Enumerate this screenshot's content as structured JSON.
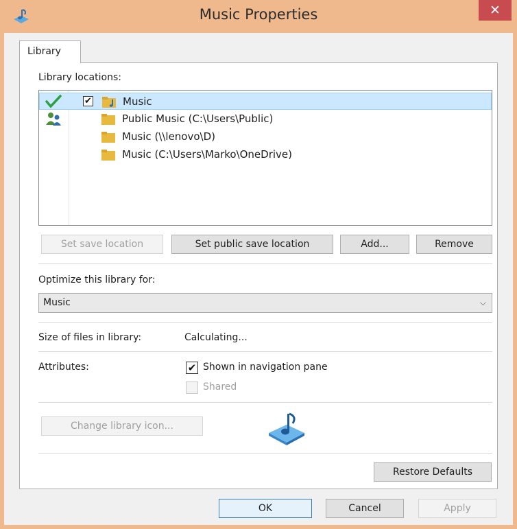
{
  "window": {
    "title": "Music Properties",
    "close_glyph": "✕",
    "title_icon": "music-library-icon"
  },
  "tab": {
    "label": "Library"
  },
  "locations": {
    "heading": "Library locations:",
    "items": [
      {
        "label": "Music",
        "checked": true,
        "status_icon": "check-mark-icon",
        "selected": true
      },
      {
        "label": "Public Music (C:\\Users\\Public)",
        "status_icon": "shared-users-icon"
      },
      {
        "label": "Music (\\\\lenovo\\D)"
      },
      {
        "label": "Music (C:\\Users\\Marko\\OneDrive)"
      }
    ]
  },
  "location_buttons": {
    "set_save": "Set save location",
    "set_public_save": "Set public save location",
    "add": "Add...",
    "remove": "Remove"
  },
  "optimize": {
    "label": "Optimize this library for:",
    "selected": "Music"
  },
  "size": {
    "label": "Size of files in library:",
    "value": "Calculating..."
  },
  "attributes": {
    "label": "Attributes:",
    "shown_in_nav": {
      "label": "Shown in navigation pane",
      "checked": true
    },
    "shared": {
      "label": "Shared",
      "checked": false
    }
  },
  "icon_section": {
    "change_icon_label": "Change library icon...",
    "preview_icon": "music-note-icon"
  },
  "restore_defaults": "Restore Defaults",
  "dialog_buttons": {
    "ok": "OK",
    "cancel": "Cancel",
    "apply": "Apply"
  },
  "colors": {
    "titlebar": "#f0b98d",
    "close": "#c74b4f",
    "selection": "#cce8ff",
    "folder": "#e8b93f"
  },
  "check_glyph": "✔"
}
